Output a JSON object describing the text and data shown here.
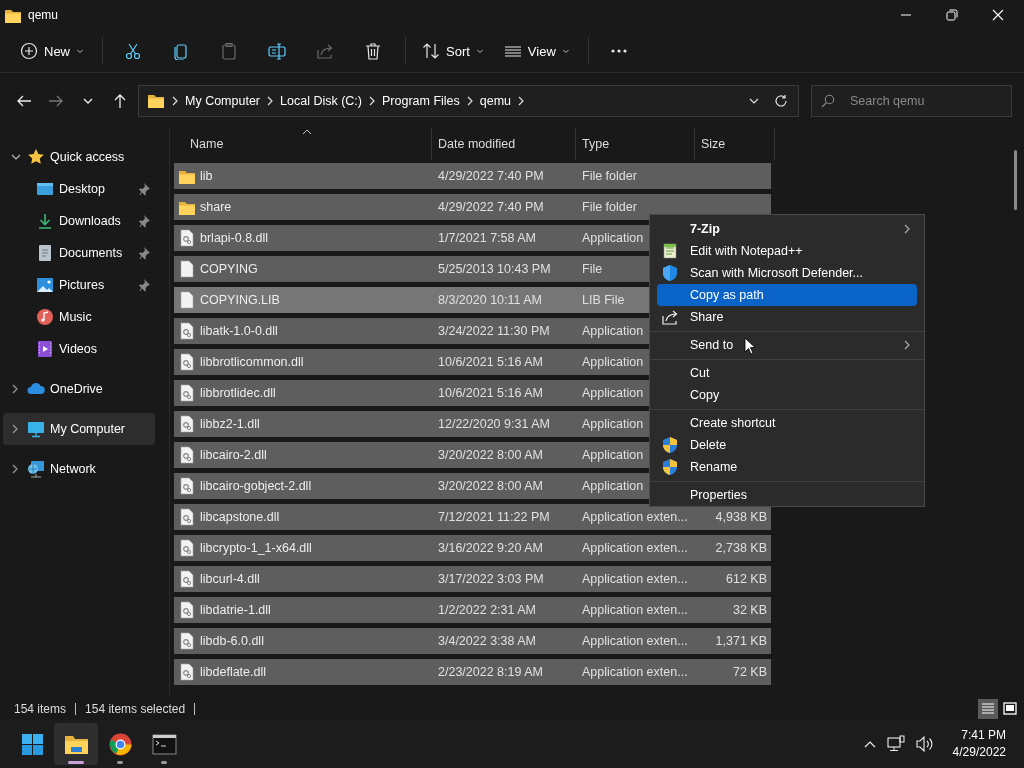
{
  "window": {
    "title": "qemu"
  },
  "toolbar": [
    {
      "kind": "new",
      "label": "New",
      "disabled": false
    },
    {
      "kind": "separator"
    },
    {
      "kind": "cut",
      "disabled": false
    },
    {
      "kind": "copy",
      "disabled": false
    },
    {
      "kind": "paste",
      "disabled": true
    },
    {
      "kind": "rename",
      "disabled": false
    },
    {
      "kind": "share",
      "disabled": true
    },
    {
      "kind": "delete",
      "disabled": false
    },
    {
      "kind": "separator"
    },
    {
      "kind": "sort",
      "label": "Sort",
      "disabled": false
    },
    {
      "kind": "view",
      "label": "View",
      "disabled": false
    },
    {
      "kind": "separator"
    },
    {
      "kind": "more",
      "disabled": false
    }
  ],
  "navigation": [
    {
      "kind": "back",
      "disabled": false
    },
    {
      "kind": "forward",
      "disabled": true
    },
    {
      "kind": "recent",
      "disabled": false
    },
    {
      "kind": "up",
      "disabled": false
    }
  ],
  "address": {
    "breadcrumbs": [
      "My Computer",
      "Local Disk (C:)",
      "Program Files",
      "qemu"
    ]
  },
  "search": {
    "placeholder": "Search qemu"
  },
  "sidebar": {
    "items": [
      {
        "label": "Quick access",
        "kind": "star",
        "expanded": true,
        "selected": false,
        "children": [
          {
            "label": "Desktop",
            "kind": "desktop",
            "pinned": true,
            "selected": false
          },
          {
            "label": "Downloads",
            "kind": "downloads",
            "pinned": true,
            "selected": false
          },
          {
            "label": "Documents",
            "kind": "documents",
            "pinned": true,
            "selected": false
          },
          {
            "label": "Pictures",
            "kind": "pictures",
            "pinned": true,
            "selected": false
          },
          {
            "label": "Music",
            "kind": "music",
            "pinned": false,
            "selected": false
          },
          {
            "label": "Videos",
            "kind": "videos",
            "pinned": false,
            "selected": false
          }
        ]
      },
      {
        "label": "OneDrive",
        "kind": "cloud",
        "expanded": false,
        "selected": false
      },
      {
        "label": "My Computer",
        "kind": "computer",
        "expanded": false,
        "selected": true
      },
      {
        "label": "Network",
        "kind": "network",
        "expanded": false,
        "selected": false
      }
    ]
  },
  "table": {
    "columns": [
      {
        "label": "Name",
        "sorted": true
      },
      {
        "label": "Date modified",
        "sorted": false
      },
      {
        "label": "Type",
        "sorted": false
      },
      {
        "label": "Size",
        "sorted": false
      }
    ],
    "rows": [
      {
        "kind": "folder",
        "name": "lib",
        "date": "4/29/2022 7:40 PM",
        "type": "File folder",
        "selected": true,
        "focused": false
      },
      {
        "kind": "folder",
        "name": "share",
        "date": "4/29/2022 7:40 PM",
        "type": "File folder",
        "selected": true,
        "focused": false
      },
      {
        "kind": "dll",
        "name": "brlapi-0.8.dll",
        "date": "1/7/2021 7:58 AM",
        "type": "Application",
        "selected": true,
        "focused": false
      },
      {
        "kind": "file",
        "name": "COPYING",
        "date": "5/25/2013 10:43 PM",
        "type": "File",
        "selected": true,
        "focused": false
      },
      {
        "kind": "file",
        "name": "COPYING.LIB",
        "date": "8/3/2020 10:11 AM",
        "type": "LIB File",
        "selected": true,
        "focused": true
      },
      {
        "kind": "dll",
        "name": "libatk-1.0-0.dll",
        "date": "3/24/2022 11:30 PM",
        "type": "Application",
        "selected": true,
        "focused": false
      },
      {
        "kind": "dll",
        "name": "libbrotlicommon.dll",
        "date": "10/6/2021 5:16 AM",
        "type": "Application",
        "selected": true,
        "focused": false
      },
      {
        "kind": "dll",
        "name": "libbrotlidec.dll",
        "date": "10/6/2021 5:16 AM",
        "type": "Application",
        "selected": true,
        "focused": false
      },
      {
        "kind": "dll",
        "name": "libbz2-1.dll",
        "date": "12/22/2020 9:31 AM",
        "type": "Application",
        "selected": true,
        "focused": false
      },
      {
        "kind": "dll",
        "name": "libcairo-2.dll",
        "date": "3/20/2022 8:00 AM",
        "type": "Application",
        "selected": true,
        "focused": false
      },
      {
        "kind": "dll",
        "name": "libcairo-gobject-2.dll",
        "date": "3/20/2022 8:00 AM",
        "type": "Application",
        "selected": true,
        "focused": false
      },
      {
        "kind": "dll",
        "name": "libcapstone.dll",
        "date": "7/12/2021 11:22 PM",
        "type": "Application exten...",
        "size": "4,938 KB",
        "selected": true,
        "focused": false
      },
      {
        "kind": "dll",
        "name": "libcrypto-1_1-x64.dll",
        "date": "3/16/2022 9:20 AM",
        "type": "Application exten...",
        "size": "2,738 KB",
        "selected": true,
        "focused": false
      },
      {
        "kind": "dll",
        "name": "libcurl-4.dll",
        "date": "3/17/2022 3:03 PM",
        "type": "Application exten...",
        "size": "612 KB",
        "selected": true,
        "focused": false
      },
      {
        "kind": "dll",
        "name": "libdatrie-1.dll",
        "date": "1/2/2022 2:31 AM",
        "type": "Application exten...",
        "size": "32 KB",
        "selected": true,
        "focused": false
      },
      {
        "kind": "dll",
        "name": "libdb-6.0.dll",
        "date": "3/4/2022 3:38 AM",
        "type": "Application exten...",
        "size": "1,371 KB",
        "selected": true,
        "focused": false
      },
      {
        "kind": "dll",
        "name": "libdeflate.dll",
        "date": "2/23/2022 8:19 AM",
        "type": "Application exten...",
        "size": "72 KB",
        "selected": true,
        "focused": false
      }
    ]
  },
  "context_menu": {
    "items": [
      {
        "kind": "plain",
        "label": "7-Zip",
        "bold": true,
        "submenu": true,
        "selected": false
      },
      {
        "kind": "notepad",
        "label": "Edit with Notepad++",
        "bold": false,
        "submenu": false,
        "selected": false
      },
      {
        "kind": "defender",
        "label": "Scan with Microsoft Defender...",
        "bold": false,
        "submenu": false,
        "selected": false
      },
      {
        "kind": "plain",
        "label": "Copy as path",
        "bold": false,
        "submenu": false,
        "selected": true
      },
      {
        "kind": "share",
        "label": "Share",
        "bold": false,
        "submenu": false,
        "selected": false
      },
      {
        "kind": "separator"
      },
      {
        "kind": "plain",
        "label": "Send to",
        "bold": false,
        "submenu": true,
        "selected": false
      },
      {
        "kind": "separator"
      },
      {
        "kind": "plain",
        "label": "Cut",
        "bold": false,
        "submenu": false,
        "selected": false
      },
      {
        "kind": "plain",
        "label": "Copy",
        "bold": false,
        "submenu": false,
        "selected": false
      },
      {
        "kind": "separator"
      },
      {
        "kind": "plain",
        "label": "Create shortcut",
        "bold": false,
        "submenu": false,
        "selected": false
      },
      {
        "kind": "uac",
        "label": "Delete",
        "bold": false,
        "submenu": false,
        "selected": false
      },
      {
        "kind": "uac",
        "label": "Rename",
        "bold": false,
        "submenu": false,
        "selected": false
      },
      {
        "kind": "separator"
      },
      {
        "kind": "plain",
        "label": "Properties",
        "bold": false,
        "submenu": false,
        "selected": false
      }
    ]
  },
  "status_bar": {
    "texts": [
      "154 items",
      "154 items selected"
    ],
    "views": [
      {
        "kind": "details",
        "selected": true
      },
      {
        "kind": "tiles",
        "selected": false
      }
    ]
  },
  "taskbar": {
    "apps": [
      {
        "kind": "start",
        "open": false,
        "active": false
      },
      {
        "kind": "explorer",
        "open": true,
        "active": true
      },
      {
        "kind": "chrome",
        "open": true,
        "active": false
      },
      {
        "kind": "terminal",
        "open": true,
        "active": false
      }
    ],
    "time": "7:41 PM",
    "date": "4/29/2022"
  }
}
